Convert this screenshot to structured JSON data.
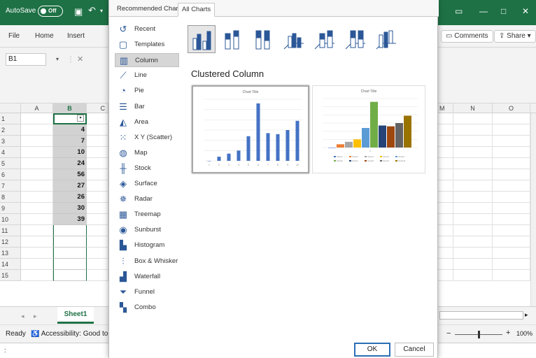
{
  "titlebar": {
    "autosave_label": "AutoSave",
    "autosave_state": "Off",
    "bg_color": "#1e7145"
  },
  "ribbon": {
    "tabs": [
      "File",
      "Home",
      "Insert"
    ],
    "comments_label": "Comments",
    "share_label": "Share",
    "name_box": "B1"
  },
  "sheet": {
    "left_columns": [
      "A",
      "B",
      "C"
    ],
    "right_columns": [
      "M",
      "N",
      "O"
    ],
    "rows": [
      "1",
      "2",
      "3",
      "4",
      "5",
      "6",
      "7",
      "8",
      "9",
      "10",
      "11",
      "12",
      "13",
      "14",
      "15"
    ],
    "column_b_values": [
      "",
      "4",
      "7",
      "10",
      "24",
      "56",
      "27",
      "26",
      "30",
      "39",
      "",
      "",
      "",
      "",
      ""
    ],
    "active_sheet": "Sheet1"
  },
  "status": {
    "ready": "Ready",
    "accessibility": "Accessibility: Good to go",
    "zoom": "100%"
  },
  "dialog": {
    "tabs": [
      "Recommended Charts",
      "All Charts"
    ],
    "active_tab": "All Charts",
    "categories": [
      {
        "label": "Recent",
        "icon": "recent-icon",
        "glyph": "↺"
      },
      {
        "label": "Templates",
        "icon": "templates-icon",
        "glyph": "▢"
      },
      {
        "label": "Column",
        "icon": "column-chart-icon",
        "glyph": "▥"
      },
      {
        "label": "Line",
        "icon": "line-chart-icon",
        "glyph": "⟋"
      },
      {
        "label": "Pie",
        "icon": "pie-chart-icon",
        "glyph": "◔"
      },
      {
        "label": "Bar",
        "icon": "bar-chart-icon",
        "glyph": "☰"
      },
      {
        "label": "Area",
        "icon": "area-chart-icon",
        "glyph": "◭"
      },
      {
        "label": "X Y (Scatter)",
        "icon": "scatter-chart-icon",
        "glyph": "⁙"
      },
      {
        "label": "Map",
        "icon": "map-chart-icon",
        "glyph": "◍"
      },
      {
        "label": "Stock",
        "icon": "stock-chart-icon",
        "glyph": "╫"
      },
      {
        "label": "Surface",
        "icon": "surface-chart-icon",
        "glyph": "◈"
      },
      {
        "label": "Radar",
        "icon": "radar-chart-icon",
        "glyph": "✵"
      },
      {
        "label": "Treemap",
        "icon": "treemap-chart-icon",
        "glyph": "▦"
      },
      {
        "label": "Sunburst",
        "icon": "sunburst-chart-icon",
        "glyph": "◉"
      },
      {
        "label": "Histogram",
        "icon": "histogram-chart-icon",
        "glyph": "▙"
      },
      {
        "label": "Box & Whisker",
        "icon": "box-whisker-chart-icon",
        "glyph": "⫶"
      },
      {
        "label": "Waterfall",
        "icon": "waterfall-chart-icon",
        "glyph": "▟"
      },
      {
        "label": "Funnel",
        "icon": "funnel-chart-icon",
        "glyph": "⏷"
      },
      {
        "label": "Combo",
        "icon": "combo-chart-icon",
        "glyph": "▚"
      }
    ],
    "active_category": "Column",
    "subtype_heading": "Clustered Column",
    "preview_title": "Chart Title",
    "ok_label": "OK",
    "cancel_label": "Cancel",
    "accent": "#4472c4"
  },
  "chart_data": [
    {
      "type": "bar",
      "title": "Chart Title",
      "categories": [
        "1",
        "2",
        "3",
        "4",
        "5",
        "6",
        "7",
        "8",
        "9",
        "10"
      ],
      "values": [
        0,
        4,
        7,
        10,
        24,
        56,
        27,
        26,
        30,
        39
      ],
      "color": "#4472c4"
    },
    {
      "type": "bar",
      "title": "Chart Title",
      "series": [
        {
          "name": "Series1",
          "values": [
            0
          ],
          "color": "#4472c4"
        },
        {
          "name": "Series2",
          "values": [
            4
          ],
          "color": "#ed7d31"
        },
        {
          "name": "Series3",
          "values": [
            7
          ],
          "color": "#a5a5a5"
        },
        {
          "name": "Series4",
          "values": [
            10
          ],
          "color": "#ffc000"
        },
        {
          "name": "Series5",
          "values": [
            24
          ],
          "color": "#5b9bd5"
        },
        {
          "name": "Series6",
          "values": [
            56
          ],
          "color": "#70ad47"
        },
        {
          "name": "Series7",
          "values": [
            27
          ],
          "color": "#264478"
        },
        {
          "name": "Series8",
          "values": [
            26
          ],
          "color": "#9e480e"
        },
        {
          "name": "Series9",
          "values": [
            30
          ],
          "color": "#636363"
        },
        {
          "name": "Series10",
          "values": [
            39
          ],
          "color": "#997300"
        }
      ],
      "categories": [
        "1"
      ]
    }
  ]
}
